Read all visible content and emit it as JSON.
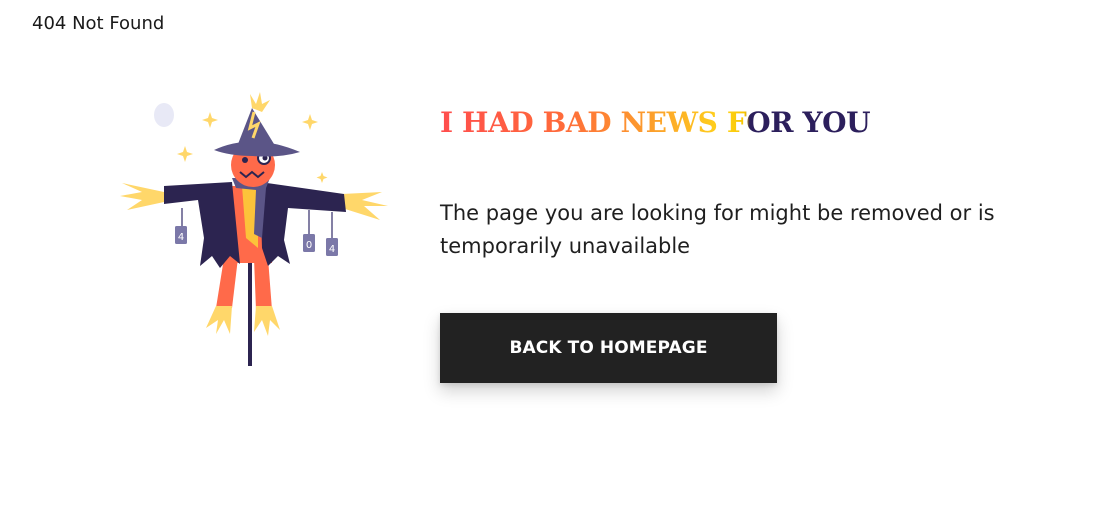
{
  "page": {
    "top_label": "404 Not Found"
  },
  "hero": {
    "heading": "I HAD BAD NEWS FOR YOU",
    "message": "The page you are looking for might be removed or is temporarily unavailable",
    "button_label": "BACK TO HOMEPAGE",
    "illustration": {
      "subject": "scarecrow",
      "tag_glyphs": [
        "4",
        "0",
        "4"
      ]
    }
  },
  "colors": {
    "background": "#ffffff",
    "button": "#222222",
    "button_text": "#ffffff",
    "heading_gradient": [
      "#ff4d4d",
      "#fca12c",
      "#ffd31a",
      "#2c1f5c"
    ],
    "scarecrow_hat": "#5b5587",
    "scarecrow_coat": "#2c2450",
    "scarecrow_face": "#ff6a4a",
    "straw": "#ffd76a"
  }
}
